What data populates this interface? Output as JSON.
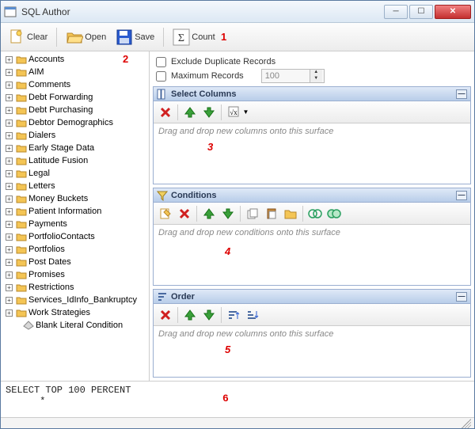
{
  "window": {
    "title": "SQL Author"
  },
  "toolbar": {
    "clear": "Clear",
    "open": "Open",
    "save": "Save",
    "count": "Count"
  },
  "annotations": {
    "a1": "1",
    "a2": "2",
    "a3": "3",
    "a4": "4",
    "a5": "5",
    "a6": "6"
  },
  "tree": {
    "items": [
      {
        "label": "Accounts"
      },
      {
        "label": "AIM"
      },
      {
        "label": "Comments"
      },
      {
        "label": "Debt Forwarding"
      },
      {
        "label": "Debt Purchasing"
      },
      {
        "label": "Debtor Demographics"
      },
      {
        "label": "Dialers"
      },
      {
        "label": "Early Stage Data"
      },
      {
        "label": "Latitude Fusion"
      },
      {
        "label": "Legal"
      },
      {
        "label": "Letters"
      },
      {
        "label": "Money Buckets"
      },
      {
        "label": "Patient Information"
      },
      {
        "label": "Payments"
      },
      {
        "label": "PortfolioContacts"
      },
      {
        "label": "Portfolios"
      },
      {
        "label": "Post Dates"
      },
      {
        "label": "Promises"
      },
      {
        "label": "Restrictions"
      },
      {
        "label": "Services_IdInfo_Bankruptcy"
      },
      {
        "label": "Work Strategies"
      }
    ],
    "child_item": {
      "label": "Blank Literal Condition"
    }
  },
  "options": {
    "exclude_label": "Exclude Duplicate Records",
    "maxrec_label": "Maximum Records",
    "maxrec_value": "100"
  },
  "panels": {
    "select": {
      "title": "Select Columns",
      "placeholder": "Drag and drop new columns onto this surface"
    },
    "conditions": {
      "title": "Conditions",
      "placeholder": "Drag and drop new conditions onto this surface"
    },
    "order": {
      "title": "Order",
      "placeholder": "Drag and drop new columns onto this surface"
    }
  },
  "sql": {
    "text": "SELECT TOP 100 PERCENT\n      *"
  },
  "icons": {
    "folder_svg": "folder",
    "sigma": "Σ"
  }
}
